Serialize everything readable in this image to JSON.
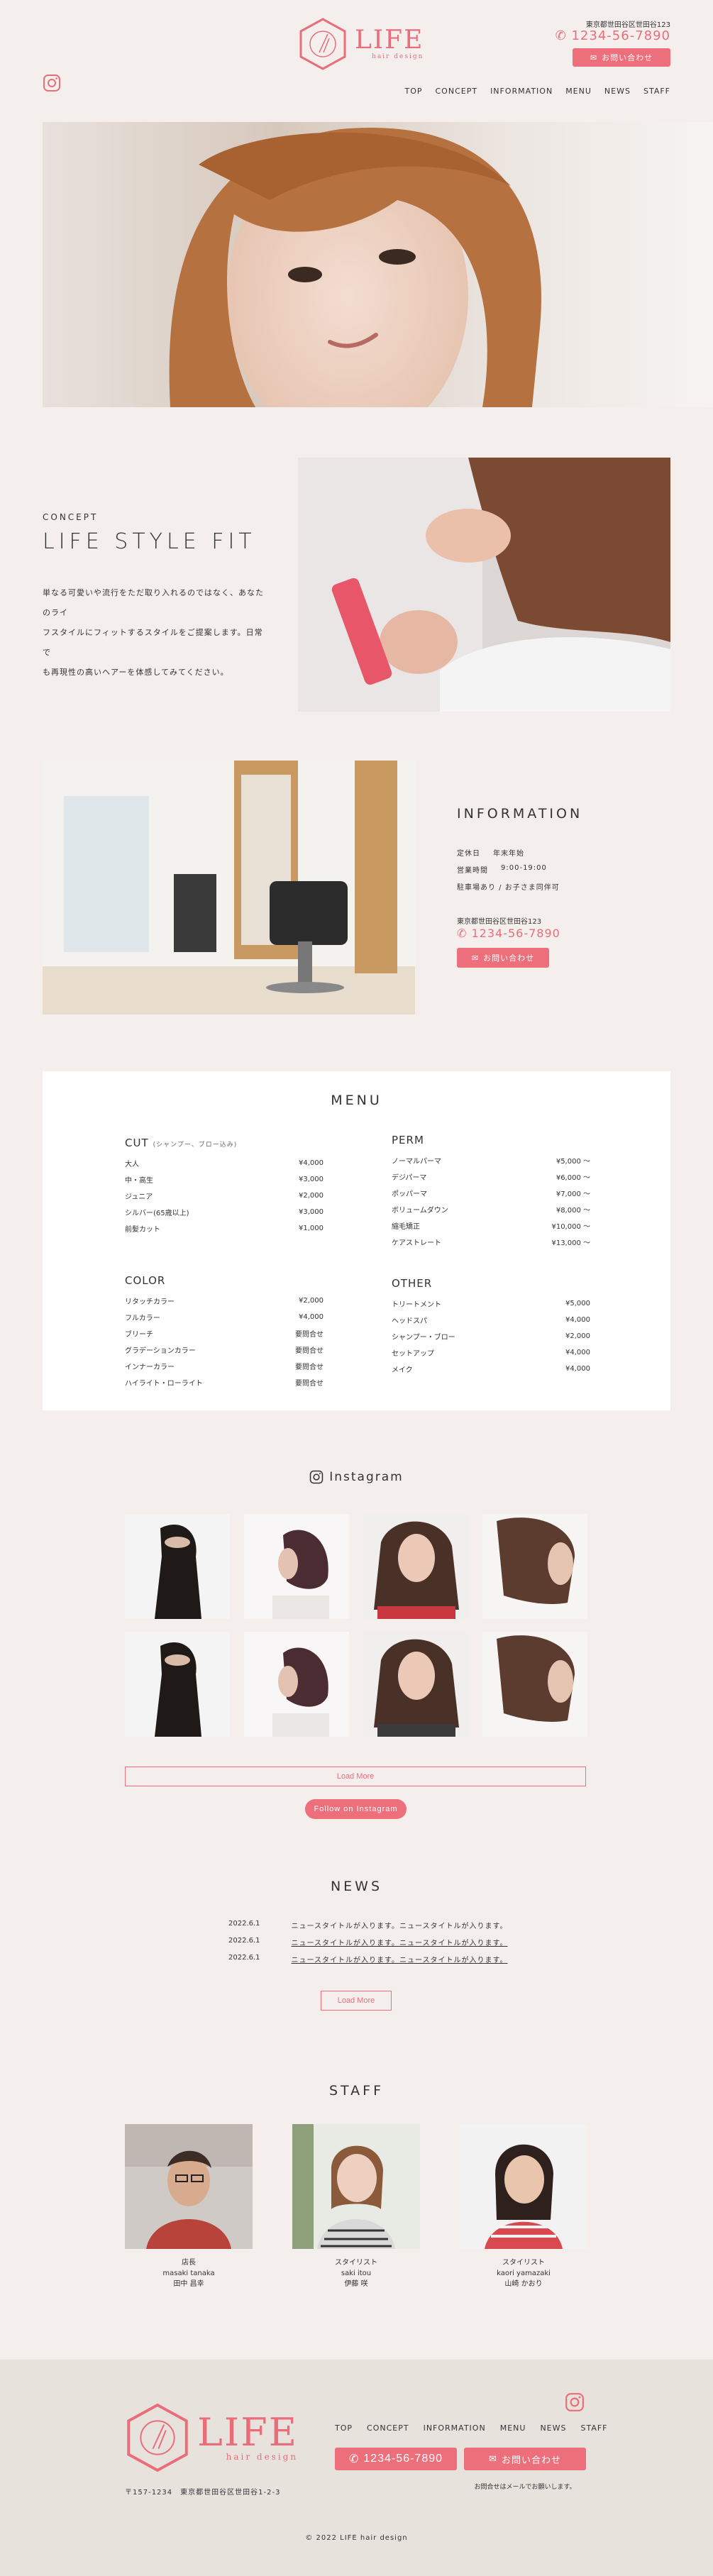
{
  "header": {
    "logo_text": "LIFE",
    "logo_sub": "hair design",
    "address": "東京都世田谷区世田谷123",
    "tel": "1234-56-7890",
    "contact_label": "お問い合わせ",
    "nav": [
      "TOP",
      "CONCEPT",
      "INFORMATION",
      "MENU",
      "NEWS",
      "STAFF"
    ]
  },
  "concept": {
    "subtitle": "CONCEPT",
    "title": "LIFE STYLE FIT",
    "text_lines": [
      "単なる可愛いや流行をただ取り入れるのではなく、あなたのライ",
      "フスタイルにフィットするスタイルをご提案します。日常で",
      "も再現性の高いヘアーを体感してみてください。"
    ]
  },
  "information": {
    "title": "INFORMATION",
    "rows": [
      {
        "label": "定休日",
        "value": "年末年始"
      },
      {
        "label": "営業時間",
        "value": "9:00-19:00"
      },
      {
        "label": "駐車場あり / お子さま同伴可",
        "value": ""
      }
    ],
    "address": "東京都世田谷区世田谷123",
    "tel": "1234-56-7890",
    "contact_label": "お問い合わせ"
  },
  "menu": {
    "title": "MENU",
    "cut": {
      "head": "CUT",
      "note": "(シャンプー、ブロー込み)",
      "items": [
        {
          "name": "大人",
          "price": "¥4,000"
        },
        {
          "name": "中・高生",
          "price": "¥3,000"
        },
        {
          "name": "ジュニア",
          "price": "¥2,000"
        },
        {
          "name": "シルバー(65歳以上)",
          "price": "¥3,000"
        },
        {
          "name": "前髪カット",
          "price": "¥1,000"
        }
      ]
    },
    "perm": {
      "head": "PERM",
      "items": [
        {
          "name": "ノーマルパーマ",
          "price": "¥5,000 〜"
        },
        {
          "name": "デジパーマ",
          "price": "¥6,000 〜"
        },
        {
          "name": "ポッパーマ",
          "price": "¥7,000 〜"
        },
        {
          "name": "ボリュームダウン",
          "price": "¥8,000 〜"
        },
        {
          "name": "縮毛矯正",
          "price": "¥10,000 〜"
        },
        {
          "name": "ケアストレート",
          "price": "¥13,000 〜"
        }
      ]
    },
    "color": {
      "head": "COLOR",
      "items": [
        {
          "name": "リタッチカラー",
          "price": "¥2,000"
        },
        {
          "name": "フルカラー",
          "price": "¥4,000"
        },
        {
          "name": "ブリーチ",
          "price": "要問合せ"
        },
        {
          "name": "グラデーションカラー",
          "price": "要問合せ"
        },
        {
          "name": "インナーカラー",
          "price": "要問合せ"
        },
        {
          "name": "ハイライト・ローライト",
          "price": "要問合せ"
        }
      ]
    },
    "other": {
      "head": "OTHER",
      "items": [
        {
          "name": "トリートメント",
          "price": "¥5,000"
        },
        {
          "name": "ヘッドスパ",
          "price": "¥4,000"
        },
        {
          "name": "シャンプー・ブロー",
          "price": "¥2,000"
        },
        {
          "name": "セットアップ",
          "price": "¥4,000"
        },
        {
          "name": "メイク",
          "price": "¥4,000"
        }
      ]
    }
  },
  "instagram": {
    "title": "Instagram",
    "load_more": "Load More",
    "follow": "Follow on Instagram"
  },
  "news": {
    "title": "NEWS",
    "items": [
      {
        "date": "2022.6.1",
        "text": "ニュースタイトルが入ります。ニュースタイトルが入ります。"
      },
      {
        "date": "2022.6.1",
        "text": "ニュースタイトルが入ります。ニュースタイトルが入ります。"
      },
      {
        "date": "2022.6.1",
        "text": "ニュースタイトルが入ります。ニュースタイトルが入ります。"
      }
    ],
    "load_more": "Load More"
  },
  "staff": {
    "title": "STAFF",
    "members": [
      {
        "role": "店長",
        "roman": "masaki tanaka",
        "name": "田中 昌幸"
      },
      {
        "role": "スタイリスト",
        "roman": "saki itou",
        "name": "伊藤 咲"
      },
      {
        "role": "スタイリスト",
        "roman": "kaori yamazaki",
        "name": "山崎 かおり"
      }
    ]
  },
  "footer": {
    "logo_text": "LIFE",
    "logo_sub": "hair design",
    "address": "〒157-1234　東京都世田谷区世田谷1-2-3",
    "nav": [
      "TOP",
      "CONCEPT",
      "INFORMATION",
      "MENU",
      "NEWS",
      "STAFF"
    ],
    "tel": "1234-56-7890",
    "contact_label": "お問い合わせ",
    "note": "お問合せはメールでお願いします。",
    "copyright": "© 2022 LIFE hair design"
  },
  "colors": {
    "accent": "#ec6f7b",
    "background": "#f4efed",
    "footer": "#e8e2dd"
  }
}
